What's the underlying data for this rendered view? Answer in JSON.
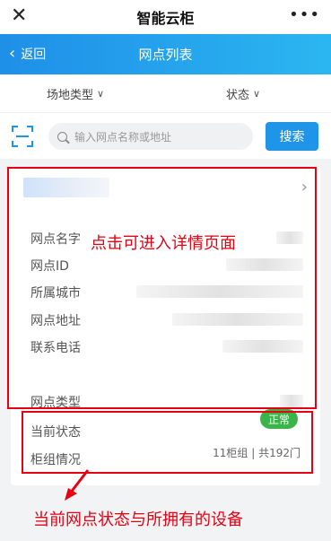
{
  "app": {
    "title": "智能云柜"
  },
  "nav": {
    "back_label": "返回",
    "title": "网点列表"
  },
  "filters": [
    {
      "label": "场地类型"
    },
    {
      "label": "状态"
    }
  ],
  "search": {
    "placeholder": "输入网点名称或地址",
    "button_label": "搜索"
  },
  "card": {
    "fields": [
      {
        "label": "网点名字"
      },
      {
        "label": "网点ID"
      },
      {
        "label": "所属城市"
      },
      {
        "label": "网点地址"
      },
      {
        "label": "联系电话"
      },
      {
        "label": "网点类型"
      }
    ],
    "status_label": "当前状态",
    "status_value": "正常",
    "group_label": "柜组情况",
    "group_value": "11柜组 | 共192门"
  },
  "annotations": {
    "detail_hint": "点击可进入详情页面",
    "status_hint": "当前网点状态与所拥有的设备"
  },
  "colors": {
    "accent": "#1f95ea",
    "status_ok": "#3bb54a",
    "annotation": "#e60012"
  }
}
